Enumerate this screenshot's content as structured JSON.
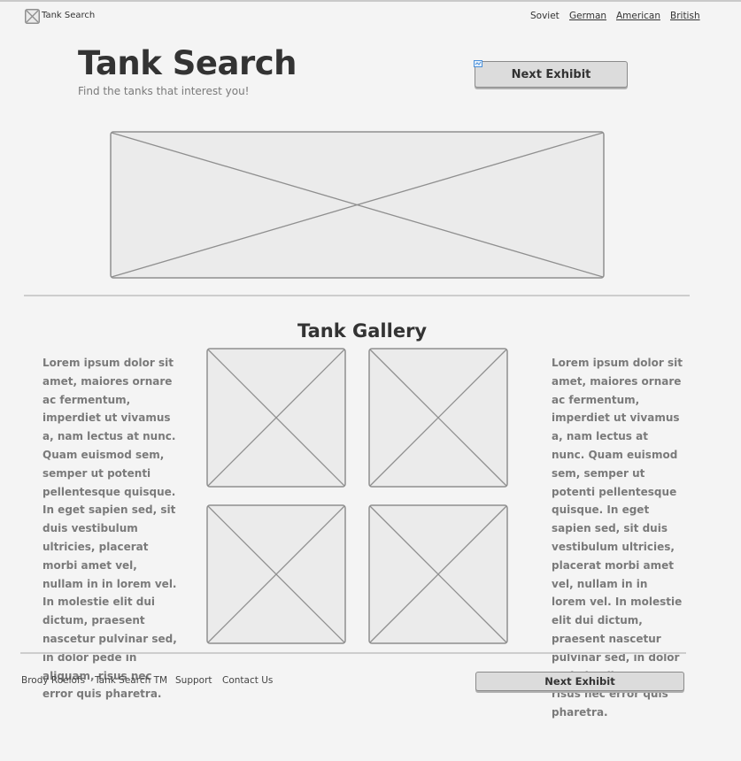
{
  "header": {
    "logo_text": "Tank Search",
    "logo_icon": "image-placeholder-icon",
    "nav": [
      {
        "label": "Soviet"
      },
      {
        "label": "German"
      },
      {
        "label": "American"
      },
      {
        "label": "British"
      }
    ]
  },
  "hero": {
    "title": "Tank Search",
    "subtitle": "Find the tanks that interest you!",
    "next_button": "Next Exhibit",
    "banner_image": "image-placeholder"
  },
  "gallery": {
    "title": "Tank Gallery",
    "left_text": "Lorem ipsum dolor sit amet, maiores ornare ac fermentum, imperdiet ut vivamus a, nam lectus at nunc. Quam euismod sem, semper ut potenti pellentesque quisque. In eget sapien sed, sit duis vestibulum ultricies, placerat morbi amet vel, nullam in in lorem vel. In molestie elit dui dictum, praesent nascetur pulvinar sed, in dolor pede in aliquam, risus nec error quis pharetra.",
    "right_text": "Lorem ipsum dolor sit amet, maiores ornare ac fermentum, imperdiet ut vivamus a, nam lectus at nunc. Quam euismod sem, semper ut potenti pellentesque quisque. In eget sapien sed, sit duis vestibulum ultricies, placerat morbi amet vel, nullam in in lorem vel. In molestie elit dui dictum, praesent nascetur pulvinar sed, in dolor pede in aliquam, risus nec error quis pharetra.",
    "images": [
      "image-placeholder",
      "image-placeholder",
      "image-placeholder",
      "image-placeholder"
    ]
  },
  "footer": {
    "links": [
      {
        "label": "Brody Roelofs"
      },
      {
        "label": "Tank Search TM"
      },
      {
        "label": "Support"
      },
      {
        "label": "Contact Us"
      }
    ],
    "next_button": "Next Exhibit"
  },
  "colors": {
    "background": "#f4f4f4",
    "placeholder_fill": "#ebebeb",
    "placeholder_stroke": "#8f8f8f",
    "button_fill": "#dcdcdc",
    "text_dark": "#333333",
    "text_muted": "#7a7a7a"
  }
}
